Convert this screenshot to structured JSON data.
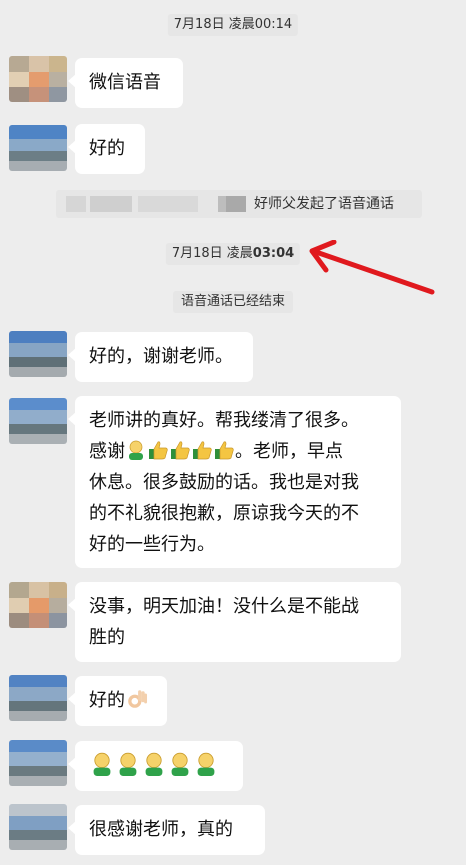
{
  "timestamps": {
    "t1": "7月18日 凌晨00:14",
    "t2_date": "7月18日 凌晨",
    "t2_time": "03:04"
  },
  "system": {
    "call_started": "好师父发起了语音通话",
    "call_ended": "语音通话已经结束"
  },
  "messages": [
    {
      "text": "微信语音"
    },
    {
      "text": "好的"
    },
    {
      "text": "好的，谢谢老师。"
    },
    {
      "line1": "老师讲的真好。帮我缕清了很多。",
      "line2_a": "感谢",
      "line2_b": "。老师，早点",
      "line3": "休息。很多鼓励的话。我也是对我",
      "line4": "的不礼貌很抱歉，原谅我今天的不",
      "line5": "好的一些行为。"
    },
    {
      "line1": "没事，明天加油！没什么是不能战",
      "line2": "胜的"
    },
    {
      "text": "好的"
    },
    {
      "emojis": [
        "face-green-shirt",
        "face-green-shirt",
        "face-green-shirt",
        "face-green-shirt",
        "face-green-shirt"
      ]
    },
    {
      "text": "很感谢老师，真的"
    }
  ],
  "icons": {
    "thumbs": "thumbs-up-icon",
    "ok_hand": "ok-hand-icon",
    "person": "face-green-shirt"
  },
  "colors": {
    "background": "#ededed",
    "bubble": "#ffffff",
    "annotation_arrow": "#e0191e"
  }
}
